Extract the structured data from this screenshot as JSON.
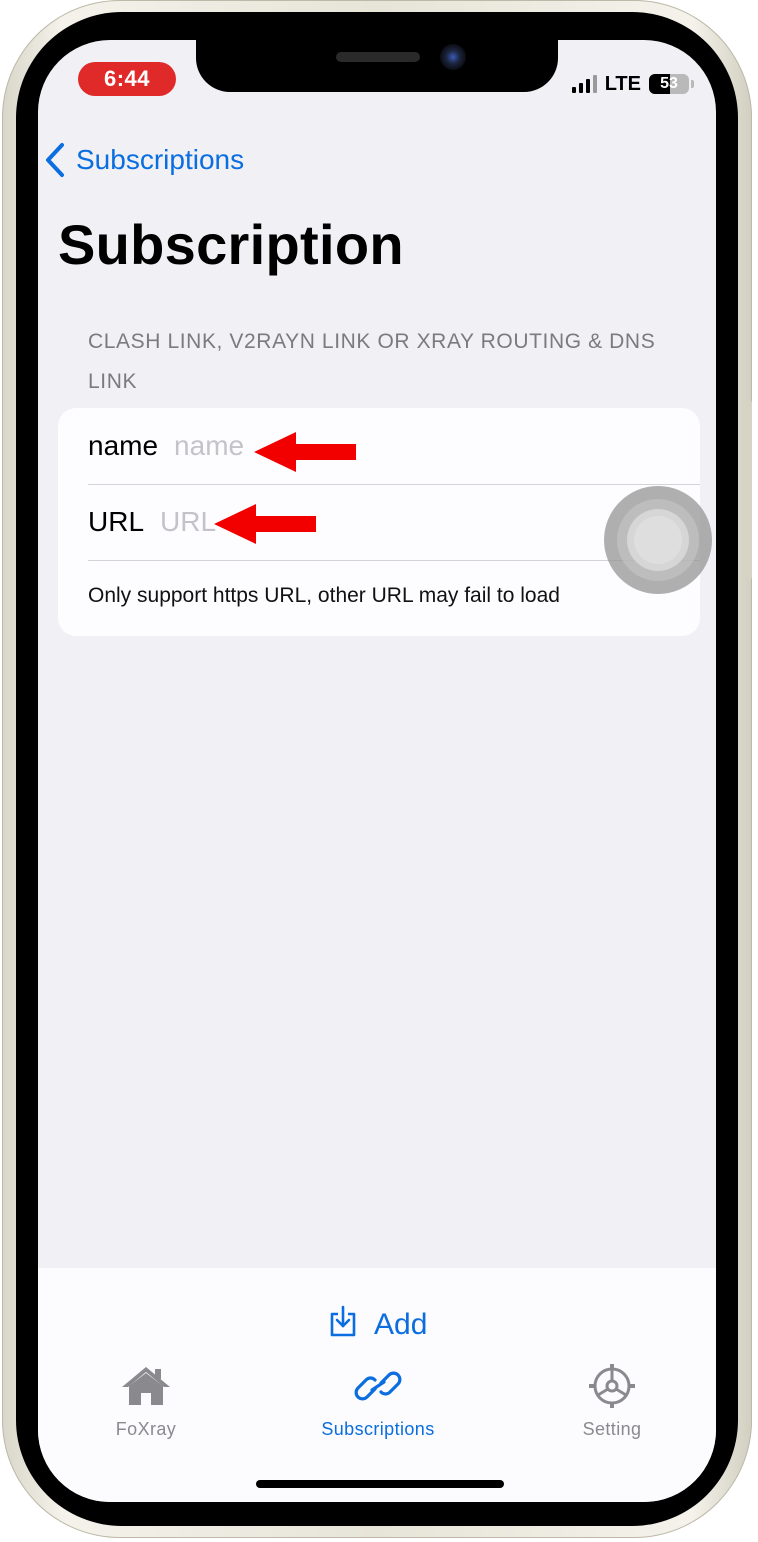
{
  "status_bar": {
    "time": "6:44",
    "network": "LTE",
    "battery_level": "53"
  },
  "nav": {
    "back_label": "Subscriptions"
  },
  "page": {
    "title": "Subscription"
  },
  "form": {
    "section_header": "CLASH LINK, V2RAYN LINK OR XRAY ROUTING & DNS LINK",
    "name_label": "name",
    "name_placeholder": "name",
    "name_value": "",
    "url_label": "URL",
    "url_placeholder": "URL",
    "url_value": "",
    "footer_note": "Only support https URL, other URL may fail to load"
  },
  "actions": {
    "add_label": "Add"
  },
  "tab_bar": {
    "tabs": [
      {
        "label": "FoXray",
        "icon": "house-icon",
        "active": false
      },
      {
        "label": "Subscriptions",
        "icon": "link-icon",
        "active": true
      },
      {
        "label": "Setting",
        "icon": "gear-icon",
        "active": false
      }
    ]
  },
  "colors": {
    "accent": "#0a6ee0",
    "time_pill": "#e02a2a",
    "annotation_arrow": "#f20000",
    "background": "#f0f0f5"
  }
}
